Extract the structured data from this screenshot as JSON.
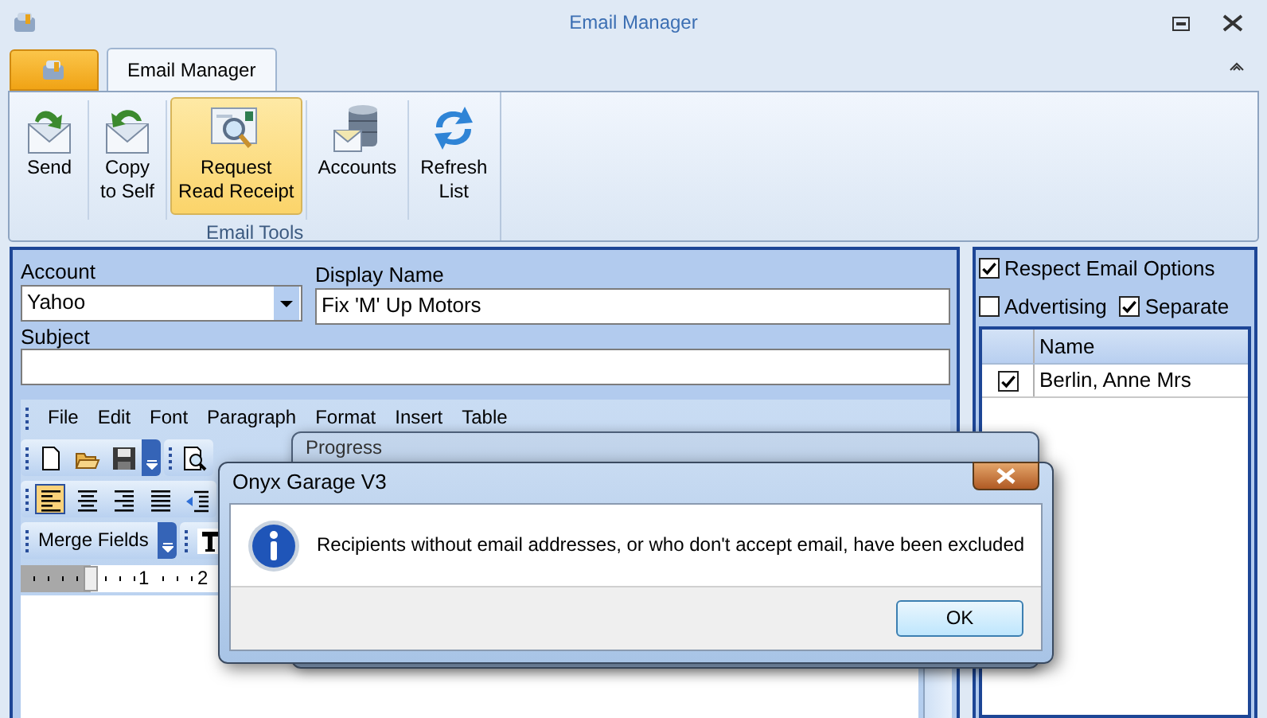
{
  "window": {
    "title": "Email Manager"
  },
  "ribbon": {
    "tabs": [
      {
        "label": "Email Manager",
        "selected": true
      }
    ],
    "groups": [
      {
        "label": "Email Tools",
        "buttons": [
          {
            "kind": "send",
            "label": "Send",
            "selected": false
          },
          {
            "kind": "copy",
            "label": "Copy\nto Self",
            "selected": false
          },
          {
            "kind": "receipt",
            "label": "Request\nRead Receipt",
            "selected": true
          },
          {
            "kind": "accounts",
            "label": "Accounts",
            "selected": false
          },
          {
            "kind": "refresh",
            "label": "Refresh\nList",
            "selected": false
          }
        ]
      }
    ]
  },
  "message": {
    "account": {
      "label": "Account",
      "value": "Yahoo"
    },
    "display_name": {
      "label": "Display Name",
      "value": "Fix 'M' Up Motors"
    },
    "subject": {
      "label": "Subject"
    }
  },
  "editor": {
    "menu": [
      "File",
      "Edit",
      "Font",
      "Paragraph",
      "Format",
      "Insert",
      "Table"
    ],
    "alignment": [
      {
        "kind": "left",
        "selected": true
      },
      {
        "kind": "center",
        "selected": false
      },
      {
        "kind": "right",
        "selected": false
      },
      {
        "kind": "justify",
        "selected": false
      }
    ],
    "merge_fields": "Merge Fields",
    "ruler": [
      "1",
      "2"
    ]
  },
  "recipients": {
    "options": [
      {
        "label": "Respect Email Options",
        "checked": true
      },
      {
        "label": "Advertising",
        "checked": false
      },
      {
        "label": "Separate",
        "checked": true
      }
    ],
    "columns": [
      "Name"
    ],
    "rows": [
      {
        "checked": true,
        "name": "Berlin, Anne Mrs"
      }
    ]
  },
  "progress_window": {
    "title": "Progress"
  },
  "dialog": {
    "title": "Onyx Garage V3",
    "text": "Recipients without email addresses, or who don't accept email, have been excluded",
    "buttons": [
      "OK"
    ]
  }
}
